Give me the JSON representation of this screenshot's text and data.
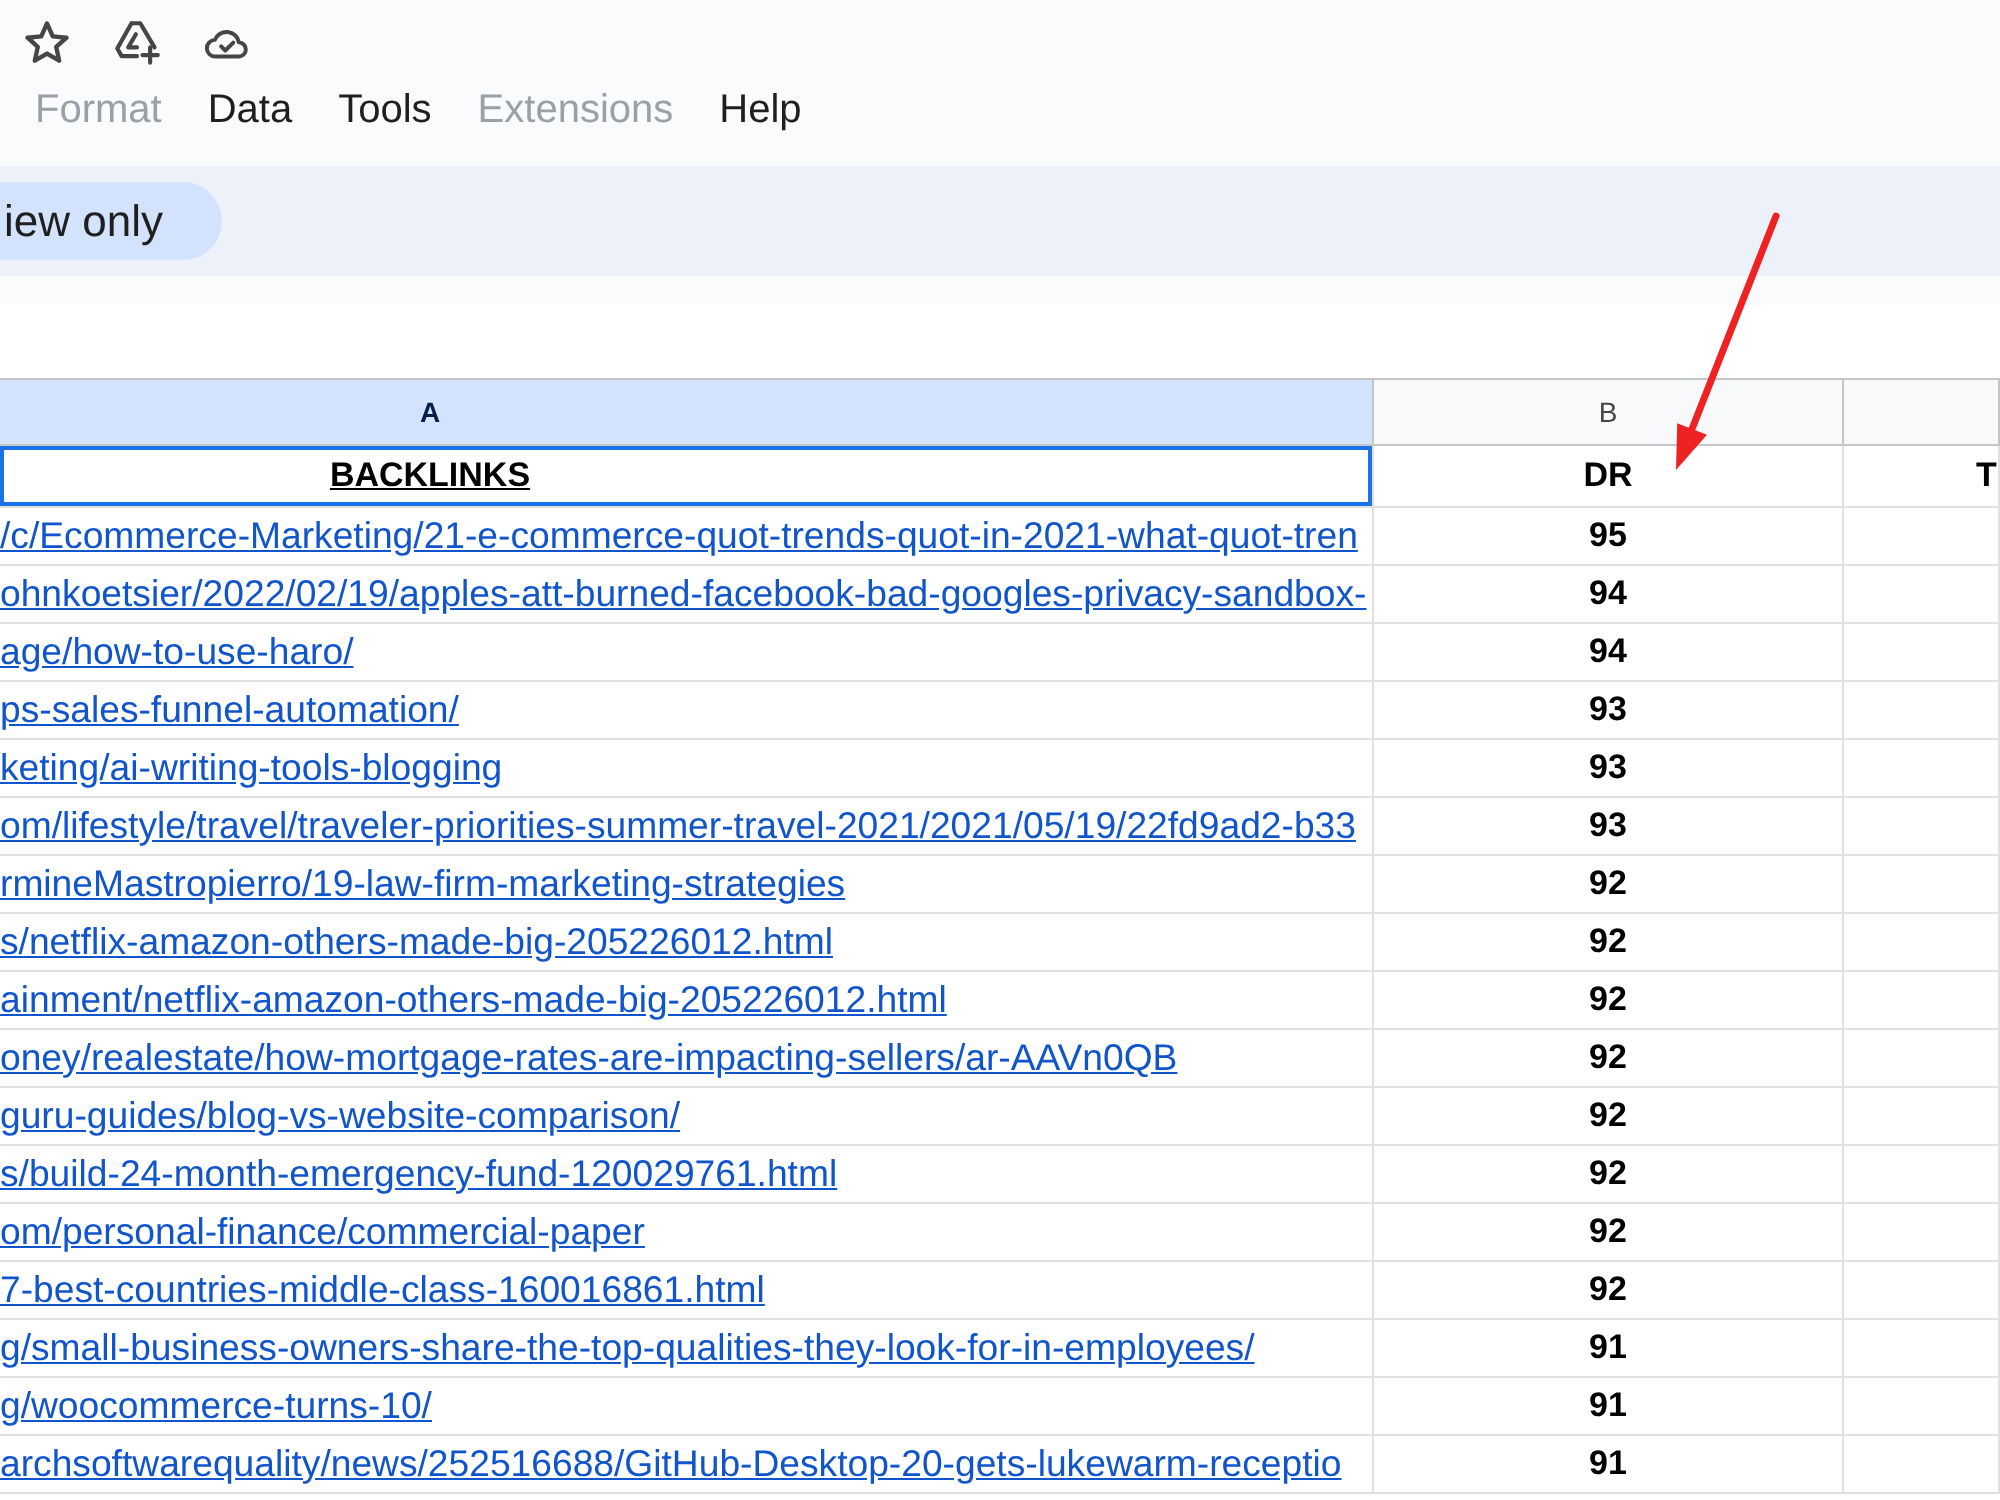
{
  "menu": [
    {
      "label": "Format",
      "disabled": true
    },
    {
      "label": "Data",
      "disabled": false
    },
    {
      "label": "Tools",
      "disabled": false
    },
    {
      "label": "Extensions",
      "disabled": true
    },
    {
      "label": "Help",
      "disabled": false
    }
  ],
  "mode_chip": {
    "label": "iew only"
  },
  "sheet": {
    "columns": [
      {
        "letter": "A",
        "selected": true
      },
      {
        "letter": "B",
        "selected": false
      },
      {
        "selected": false
      }
    ],
    "header_row": [
      {
        "text": "BACKLINKS",
        "selected": true
      },
      {
        "text": "DR",
        "selected": false
      },
      {
        "text": "T",
        "selected": false
      }
    ],
    "rows": [
      {
        "backlink": "/c/Ecommerce-Marketing/21-e-commerce-quot-trends-quot-in-2021-what-quot-tren",
        "dr": "95"
      },
      {
        "backlink": "ohnkoetsier/2022/02/19/apples-att-burned-facebook-bad-googles-privacy-sandbox-",
        "dr": "94"
      },
      {
        "backlink": "age/how-to-use-haro/",
        "dr": "94"
      },
      {
        "backlink": "ps-sales-funnel-automation/",
        "dr": "93"
      },
      {
        "backlink": "keting/ai-writing-tools-blogging",
        "dr": "93"
      },
      {
        "backlink": "om/lifestyle/travel/traveler-priorities-summer-travel-2021/2021/05/19/22fd9ad2-b33",
        "dr": "93"
      },
      {
        "backlink": "rmineMastropierro/19-law-firm-marketing-strategies",
        "dr": "92"
      },
      {
        "backlink": "s/netflix-amazon-others-made-big-205226012.html",
        "dr": "92"
      },
      {
        "backlink": "ainment/netflix-amazon-others-made-big-205226012.html",
        "dr": "92"
      },
      {
        "backlink": "oney/realestate/how-mortgage-rates-are-impacting-sellers/ar-AAVn0QB",
        "dr": "92"
      },
      {
        "backlink": "guru-guides/blog-vs-website-comparison/",
        "dr": "92"
      },
      {
        "backlink": "s/build-24-month-emergency-fund-120029761.html",
        "dr": "92"
      },
      {
        "backlink": "om/personal-finance/commercial-paper",
        "dr": "92"
      },
      {
        "backlink": "7-best-countries-middle-class-160016861.html",
        "dr": "92"
      },
      {
        "backlink": "g/small-business-owners-share-the-top-qualities-they-look-for-in-employees/",
        "dr": "91"
      },
      {
        "backlink": "g/woocommerce-turns-10/",
        "dr": "91"
      },
      {
        "backlink": "archsoftwarequality/news/252516688/GitHub-Desktop-20-gets-lukewarm-receptio",
        "dr": "91"
      }
    ]
  }
}
